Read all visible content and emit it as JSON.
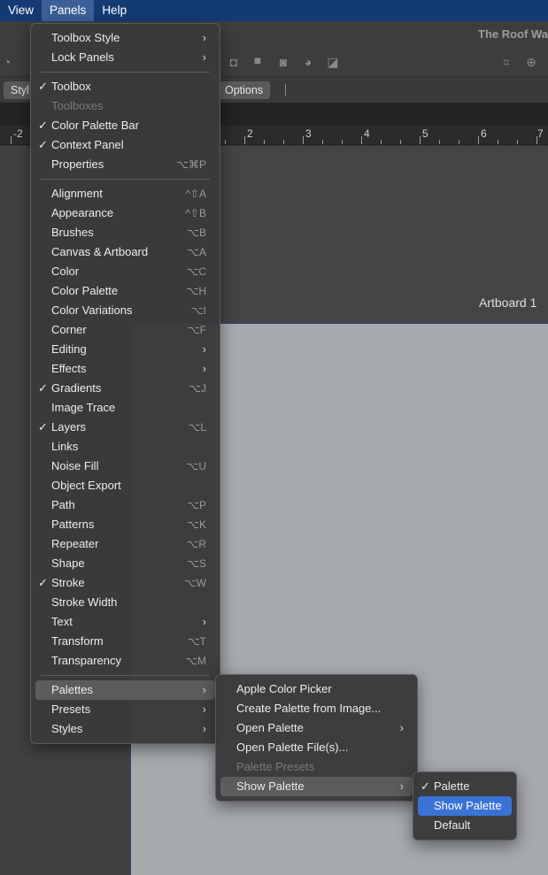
{
  "menubar": {
    "items": [
      "View",
      "Panels",
      "Help"
    ]
  },
  "document": {
    "title": "The Roof Wa"
  },
  "context_bar": {
    "left_label": "Styl",
    "options_label": "Options"
  },
  "ruler": {
    "labels": [
      "-2",
      "2",
      "3",
      "4",
      "5",
      "6",
      "7"
    ]
  },
  "canvas": {
    "artboard_label": "Artboard 1"
  },
  "panels_menu": {
    "items": [
      {
        "label": "Toolbox Style",
        "submenu": true
      },
      {
        "label": "Lock Panels",
        "submenu": true
      },
      {
        "sep": true
      },
      {
        "label": "Toolbox",
        "checked": true
      },
      {
        "label": "Toolboxes",
        "disabled": true
      },
      {
        "label": "Color Palette Bar",
        "checked": true
      },
      {
        "label": "Context Panel",
        "checked": true
      },
      {
        "label": "Properties",
        "shortcut": "⌥⌘P"
      },
      {
        "sep": true
      },
      {
        "label": "Alignment",
        "shortcut": "^⇧A"
      },
      {
        "label": "Appearance",
        "shortcut": "^⇧B"
      },
      {
        "label": "Brushes",
        "shortcut": "⌥B"
      },
      {
        "label": "Canvas & Artboard",
        "shortcut": "⌥A"
      },
      {
        "label": "Color",
        "shortcut": "⌥C"
      },
      {
        "label": "Color Palette",
        "shortcut": "⌥H"
      },
      {
        "label": "Color Variations",
        "shortcut": "⌥I"
      },
      {
        "label": "Corner",
        "shortcut": "⌥F"
      },
      {
        "label": "Editing",
        "submenu": true
      },
      {
        "label": "Effects",
        "submenu": true
      },
      {
        "label": "Gradients",
        "checked": true,
        "shortcut": "⌥J"
      },
      {
        "label": "Image Trace"
      },
      {
        "label": "Layers",
        "checked": true,
        "shortcut": "⌥L"
      },
      {
        "label": "Links"
      },
      {
        "label": "Noise Fill",
        "shortcut": "⌥U"
      },
      {
        "label": "Object Export"
      },
      {
        "label": "Path",
        "shortcut": "⌥P"
      },
      {
        "label": "Patterns",
        "shortcut": "⌥K"
      },
      {
        "label": "Repeater",
        "shortcut": "⌥R"
      },
      {
        "label": "Shape",
        "shortcut": "⌥S"
      },
      {
        "label": "Stroke",
        "checked": true,
        "shortcut": "⌥W"
      },
      {
        "label": "Stroke Width"
      },
      {
        "label": "Text",
        "submenu": true
      },
      {
        "label": "Transform",
        "shortcut": "⌥T"
      },
      {
        "label": "Transparency",
        "shortcut": "⌥M"
      },
      {
        "sep": true
      },
      {
        "label": "Palettes",
        "submenu": true,
        "highlight": true
      },
      {
        "label": "Presets",
        "submenu": true
      },
      {
        "label": "Styles",
        "submenu": true
      }
    ]
  },
  "palettes_menu": {
    "items": [
      {
        "label": "Apple Color Picker"
      },
      {
        "label": "Create Palette from Image..."
      },
      {
        "label": "Open Palette",
        "submenu": true
      },
      {
        "label": "Open Palette File(s)..."
      },
      {
        "label": "Palette Presets",
        "disabled": true
      },
      {
        "label": "Show Palette",
        "submenu": true,
        "highlight": true
      }
    ]
  },
  "show_palette_menu": {
    "items": [
      {
        "label": "Palette",
        "checked": true
      },
      {
        "label": "Show Palette",
        "selected": true
      },
      {
        "label": "Default"
      }
    ]
  },
  "icons": {
    "check": "✓",
    "chevron": "›"
  }
}
